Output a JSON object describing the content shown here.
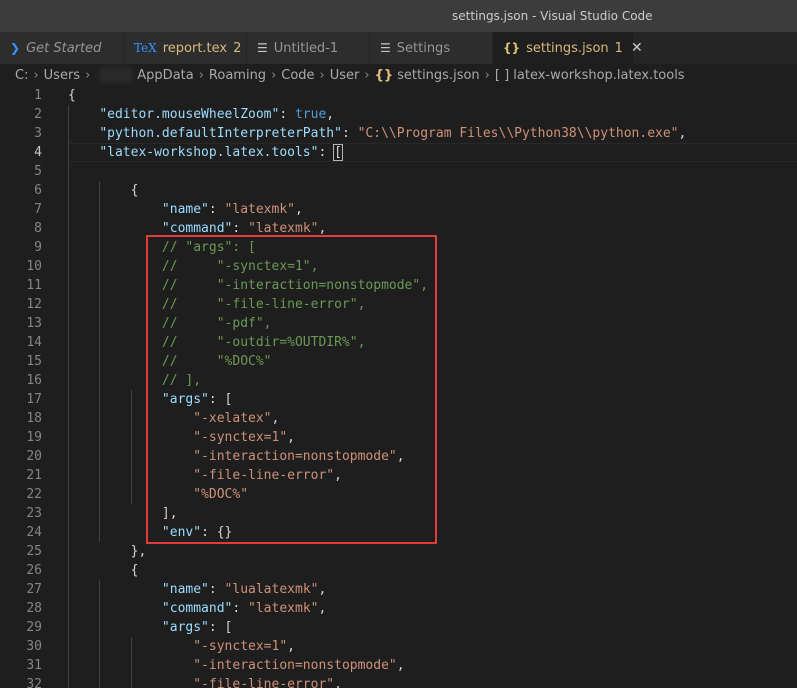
{
  "window": {
    "title": "settings.json - Visual Studio Code"
  },
  "tabs": [
    {
      "label": "Get Started",
      "icon": "vscode-logo-icon",
      "italic": true,
      "active": false
    },
    {
      "label": "report.tex",
      "badge": "2",
      "icon": "tex-icon",
      "modified": true,
      "active": false
    },
    {
      "label": "Untitled-1",
      "icon": "lines-icon",
      "active": false
    },
    {
      "label": "Settings",
      "icon": "gear-icon",
      "active": false
    },
    {
      "label": "settings.json",
      "badge": "1",
      "icon": "braces-icon",
      "modified": true,
      "active": true,
      "close": "✕"
    }
  ],
  "breadcrumb": {
    "parts": [
      "C:",
      "Users",
      "AppData",
      "Roaming",
      "Code",
      "User",
      "settings.json",
      "[ ] latex-workshop.latex.tools"
    ]
  },
  "editor": {
    "current_line": 4,
    "lines": [
      "{",
      "    \"editor.mouseWheelZoom\": true,",
      "    \"python.defaultInterpreterPath\": \"C:\\\\Program Files\\\\Python38\\\\python.exe\",",
      "    \"latex-workshop.latex.tools\": [",
      "",
      "        {",
      "            \"name\": \"latexmk\",",
      "            \"command\": \"latexmk\",",
      "            // \"args\": [",
      "            //     \"-synctex=1\",",
      "            //     \"-interaction=nonstopmode\",",
      "            //     \"-file-line-error\",",
      "            //     \"-pdf\",",
      "            //     \"-outdir=%OUTDIR%\",",
      "            //     \"%DOC%\"",
      "            // ],",
      "            \"args\": [",
      "                \"-xelatex\",",
      "                \"-synctex=1\",",
      "                \"-interaction=nonstopmode\",",
      "                \"-file-line-error\",",
      "                \"%DOC%\"",
      "            ],",
      "            \"env\": {}",
      "        },",
      "        {",
      "            \"name\": \"lualatexmk\",",
      "            \"command\": \"latexmk\",",
      "            \"args\": [",
      "                \"-synctex=1\",",
      "                \"-interaction=nonstopmode\",",
      "                \"-file-line-error\","
    ]
  },
  "colors": {
    "highlight_box": "#e03c3c",
    "key": "#9cdcfe",
    "string": "#ce9178",
    "comment": "#6a9955",
    "boolean": "#569cd6"
  }
}
